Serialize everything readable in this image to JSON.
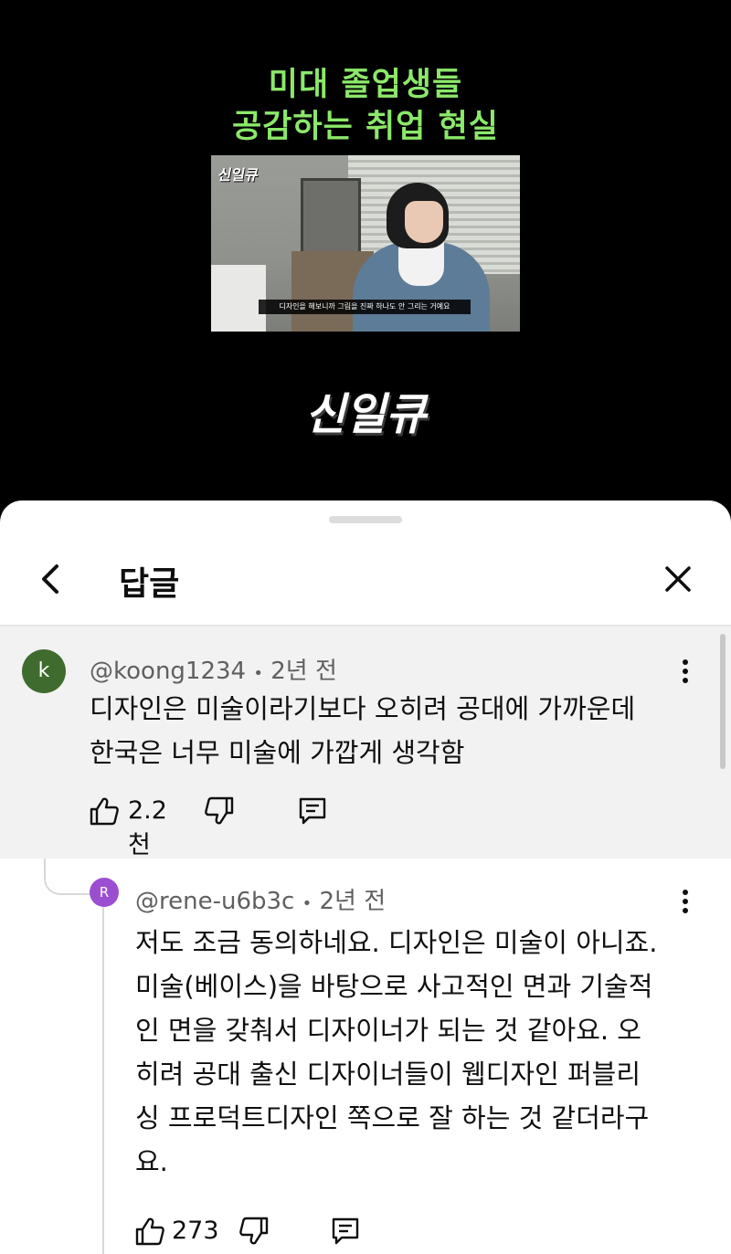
{
  "video": {
    "title_line1": "미대 졸업생들",
    "title_line2": "공감하는 취업 현실",
    "thumbnail_logo": "신일큐",
    "thumbnail_subtitle": "디자인을 해보니까 그림을 진짜 하나도 안 그리는 거예요",
    "brand_logo": "신일큐",
    "title_color": "#8be86a"
  },
  "sheet": {
    "title": "답글",
    "back_icon": "chevron-left-icon",
    "close_icon": "close-icon"
  },
  "parent_comment": {
    "avatar_letter": "k",
    "avatar_color": "#3f6b2f",
    "handle": "@koong1234",
    "separator": "•",
    "time": "2년 전",
    "line1": "디자인은 미술이라기보다 오히려 공대에 가까운데",
    "line2": "한국은 너무 미술에 가깝게 생각함",
    "likes": "2.2천"
  },
  "reply": {
    "avatar_letter": "R",
    "avatar_color": "#9b4fd0",
    "handle": "@rene-u6b3c",
    "separator": "•",
    "time": "2년 전",
    "lines": [
      "저도 조금 동의하네요. 디자인은 미술이 아니죠.",
      "미술(베이스)을 바탕으로 사고적인 면과 기술적",
      "인 면을 갖춰서 디자이너가 되는 것 같아요. 오",
      "히려 공대 출신 디자이너들이 웹디자인 퍼블리",
      "싱 프로덕트디자인 쪽으로 잘 하는 것 같더라구",
      "요."
    ],
    "likes": "273"
  }
}
